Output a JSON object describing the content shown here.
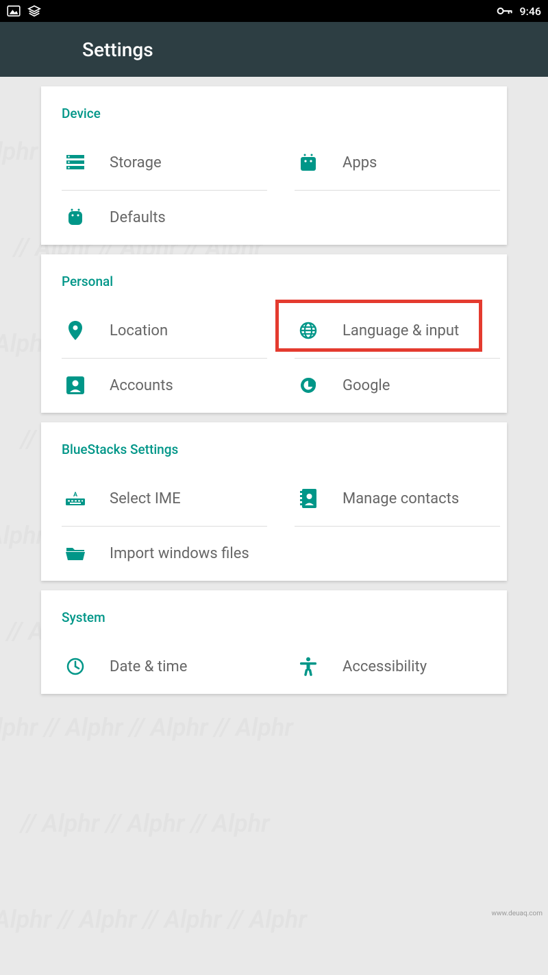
{
  "statusbar": {
    "time": "9:46"
  },
  "appbar": {
    "title": "Settings"
  },
  "sections": {
    "device": {
      "header": "Device",
      "storage": "Storage",
      "apps": "Apps",
      "defaults": "Defaults"
    },
    "personal": {
      "header": "Personal",
      "location": "Location",
      "language": "Language & input",
      "accounts": "Accounts",
      "google": "Google"
    },
    "bluestacks": {
      "header": "BlueStacks Settings",
      "selectime": "Select IME",
      "contacts": "Manage contacts",
      "import": "Import windows files"
    },
    "system": {
      "header": "System",
      "datetime": "Date & time",
      "accessibility": "Accessibility"
    }
  },
  "highlight": {
    "target": "language-input"
  },
  "footer_url": "www.deuaq.com",
  "colors": {
    "accent": "#009688",
    "appbar": "#2d3e43",
    "highlight": "#e43b2f"
  }
}
